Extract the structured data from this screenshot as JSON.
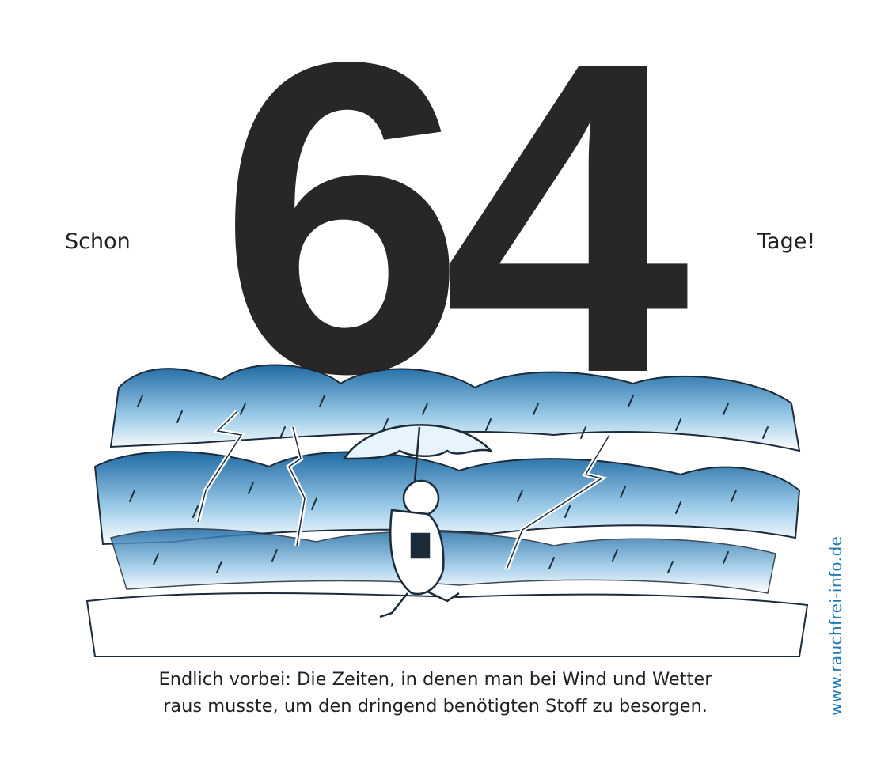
{
  "counter": {
    "prefix": "Schon",
    "number": "64",
    "suffix": "Tage!"
  },
  "caption": {
    "line1": "Endlich vorbei: Die Zeiten, in denen man bei Wind und Wetter",
    "line2": "raus musste, um den dringend benötigten Stoff zu besorgen."
  },
  "website": "www.rauchfrei-info.de",
  "illustration": {
    "subject": "cartoon-person-with-umbrella-in-thunderstorm",
    "colors": {
      "sky_dark": "#2e7fb8",
      "sky_light": "#bfe0f2",
      "text": "#231f20",
      "link": "#1f78b4"
    }
  }
}
